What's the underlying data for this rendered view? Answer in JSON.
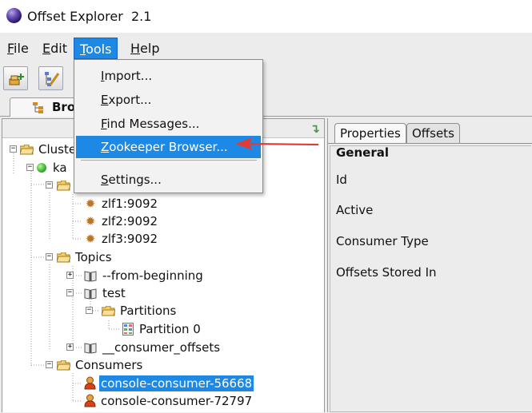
{
  "window": {
    "title": "Offset Explorer  2.1"
  },
  "menubar": {
    "items": [
      {
        "label": "File",
        "mnemonic": "F",
        "rest": "ile"
      },
      {
        "label": "Edit",
        "mnemonic": "E",
        "rest": "dit"
      },
      {
        "label": "Tools",
        "mnemonic": "T",
        "rest": "ools",
        "open": true
      },
      {
        "label": "Help",
        "mnemonic": "H",
        "rest": "elp"
      }
    ]
  },
  "tools_menu": {
    "items": [
      {
        "pre": "",
        "mnemonic": "I",
        "post": "mport..."
      },
      {
        "pre": "",
        "mnemonic": "E",
        "post": "xport..."
      },
      {
        "pre": "",
        "mnemonic": "F",
        "post": "ind Messages..."
      },
      {
        "pre": "",
        "mnemonic": "Z",
        "post": "ookeeper Browser...",
        "highlighted": true
      },
      {
        "pre": "",
        "mnemonic": "S",
        "post": "ettings..."
      }
    ]
  },
  "browser_tab": {
    "label": "Bro"
  },
  "tree": {
    "cluster_label": "Cluste",
    "connection_label": "ka",
    "brokers": [
      "zlf1:9092",
      "zlf2:9092",
      "zlf3:9092"
    ],
    "topics_label": "Topics",
    "topics": [
      "--from-beginning",
      "test",
      "__consumer_offsets"
    ],
    "partitions_label": "Partitions",
    "partition_label": "Partition 0",
    "consumers_label": "Consumers",
    "consumers": [
      {
        "label": "console-consumer-56668",
        "selected": true
      },
      {
        "label": "console-consumer-72797",
        "selected": false
      }
    ]
  },
  "right_panel": {
    "tabs": [
      {
        "label": "Properties",
        "active": true
      },
      {
        "label": "Offsets",
        "active": false
      }
    ],
    "section_title": "General",
    "properties": [
      "Id",
      "Active",
      "Consumer Type",
      "Offsets Stored In"
    ]
  },
  "colors": {
    "selection": "#1e88e5",
    "annotation_arrow": "#e53935"
  }
}
